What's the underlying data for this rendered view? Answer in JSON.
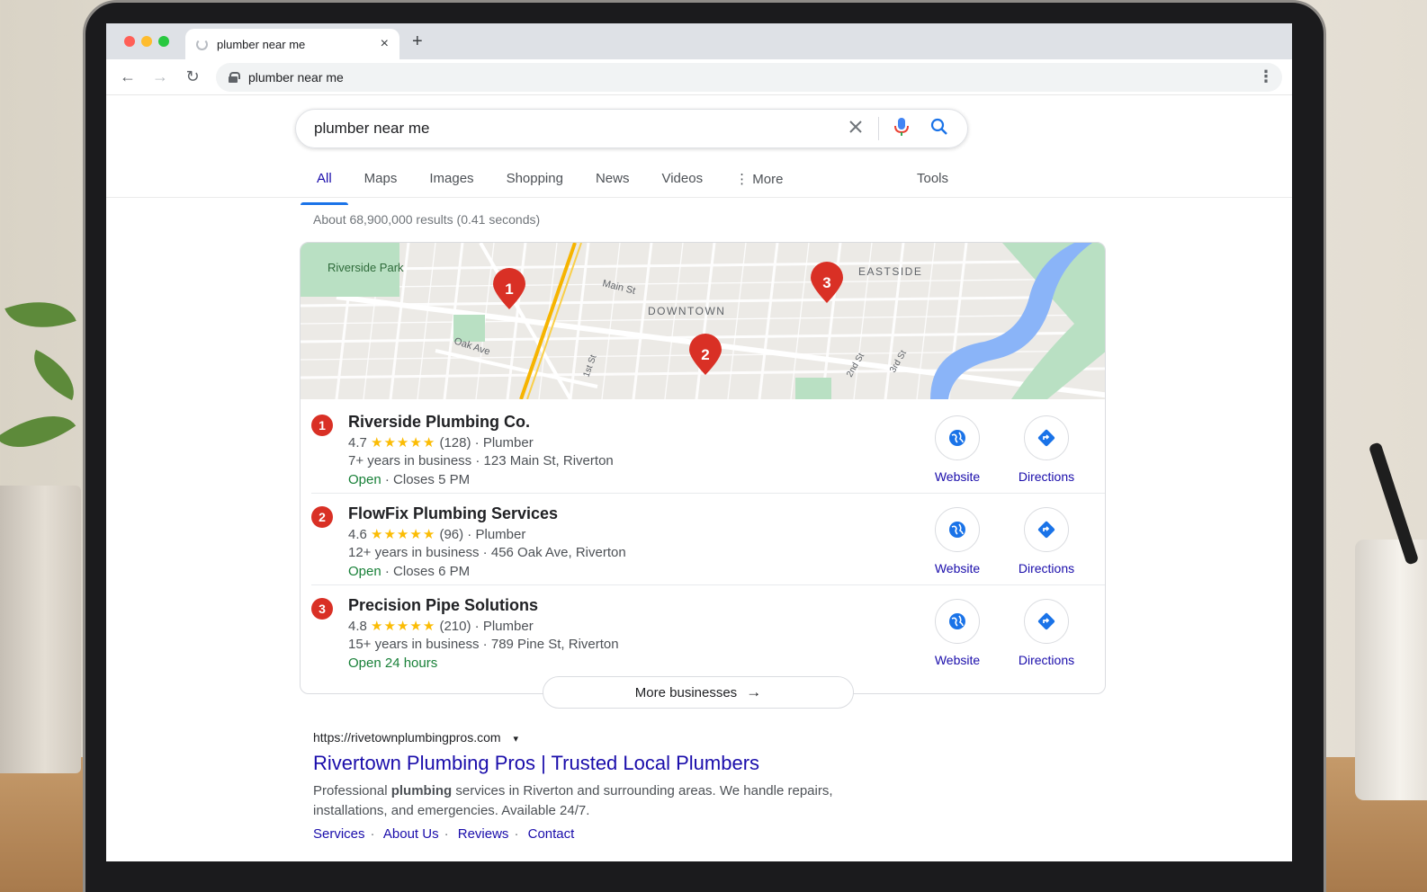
{
  "browser": {
    "tab_title": "plumber near me",
    "tab_close": "×",
    "new_tab": "+",
    "address": "plumber near me"
  },
  "search": {
    "query": "plumber near me",
    "tabs": [
      "All",
      "Maps",
      "Images",
      "Shopping",
      "News",
      "Videos",
      "⋮ More"
    ],
    "tools": "Tools",
    "stats": "About 68,900,000 results (0.41 seconds)"
  },
  "map": {
    "labels": {
      "park": "Riverside Park",
      "downtown": "DOWNTOWN",
      "eastside": "EASTSIDE",
      "main_st": "Main St",
      "oak_ave": "Oak Ave",
      "st1": "1st St",
      "st2": "2nd St",
      "st3": "3rd St"
    },
    "pins": [
      "1",
      "2",
      "3"
    ],
    "colors": {
      "pin": "#d93025",
      "river": "#8ab4f8",
      "park": "#a8dab5",
      "highway": "#f6b400"
    }
  },
  "businesses": [
    {
      "num": "1",
      "name": "Riverside Plumbing Co.",
      "rating": "4.7",
      "stars": "★★★★★",
      "reviews": "(128)",
      "category": "Plumber",
      "years": "7+ years in business",
      "address": "123 Main St, Riverton",
      "open": "Open",
      "hours": "Closes 5 PM"
    },
    {
      "num": "2",
      "name": "FlowFix Plumbing Services",
      "rating": "4.6",
      "stars": "★★★★★",
      "reviews": "(96)",
      "category": "Plumber",
      "years": "12+ years in business",
      "address": "456 Oak Ave, Riverton",
      "open": "Open",
      "hours": "Closes 6 PM"
    },
    {
      "num": "3",
      "name": "Precision Pipe Solutions",
      "rating": "4.8",
      "stars": "★★★★★",
      "reviews": "(210)",
      "category": "Plumber",
      "years": "15+ years in business",
      "address": "789 Pine St, Riverton",
      "open": "Open 24 hours",
      "hours": ""
    }
  ],
  "actions": {
    "website": "Website",
    "directions": "Directions"
  },
  "more_businesses": "More businesses",
  "organic": {
    "url": "https://rivetownplumbingpros.com",
    "title": "Rivertown Plumbing Pros | Trusted Local Plumbers",
    "snippet_pre": "Professional ",
    "snippet_bold": "plumbing",
    "snippet_post": " services in Riverton and surrounding areas. We handle repairs, installations, and emergencies. Available 24/7.",
    "links": [
      "Services",
      "About Us",
      "Reviews",
      "Contact"
    ]
  },
  "colors": {
    "link": "#1a0dab",
    "accent": "#1a73e8",
    "open": "#188038",
    "star": "#fbbc04"
  }
}
